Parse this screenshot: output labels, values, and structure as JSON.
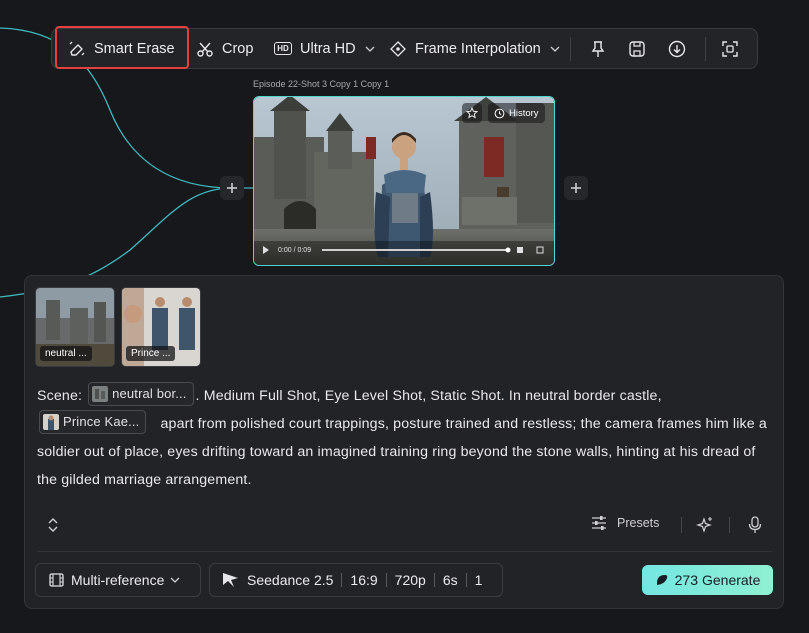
{
  "toolbar": {
    "smart_erase": "Smart Erase",
    "crop": "Crop",
    "ultra_hd": "Ultra HD",
    "frame_interpolation": "Frame Interpolation",
    "hd_badge": "HD"
  },
  "node": {
    "title": "Episode 22-Shot 3 Copy 1 Copy 1",
    "history_label": "History",
    "time": "0:00 / 0:09"
  },
  "references": [
    {
      "label": "neutral ..."
    },
    {
      "label": "Prince ..."
    }
  ],
  "prompt": {
    "scene_label": "Scene:",
    "chip1": "neutral bor...",
    "text1": ". Medium Full Shot, Eye Level Shot, Static Shot. In neutral border castle,",
    "chip2": "Prince Kae...",
    "text2": " apart from polished court trappings, posture trained and restless; the camera frames him like a soldier out of place, eyes drifting toward an imagined training ring beyond the stone walls, hinting at his dread of the gilded marriage arrangement."
  },
  "controls": {
    "presets": "Presets",
    "mode": "Multi-reference",
    "model": "Seedance 2.5",
    "ratio": "16:9",
    "resolution": "720p",
    "duration": "6s",
    "count": "1",
    "credits": "273",
    "generate": "Generate"
  },
  "colors": {
    "accent": "#4fd6cf",
    "highlight": "#e44040",
    "generate_gradient_start": "#74e6e2",
    "generate_gradient_end": "#8ff0d2"
  }
}
